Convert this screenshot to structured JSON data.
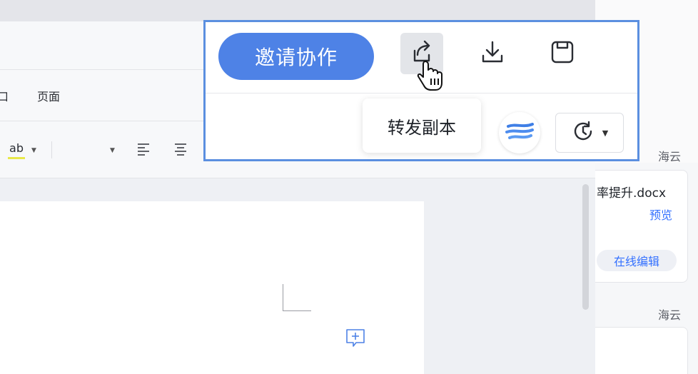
{
  "menu": {
    "partial_item": "口",
    "page_item": "页面"
  },
  "format_bar": {
    "highlight_label": "ab"
  },
  "toolbar": {
    "invite_label": "邀请协作",
    "share_tooltip": "转发副本",
    "share_icon": "share-icon",
    "download_icon": "download-icon",
    "save_icon": "save-icon",
    "history_icon": "history-icon",
    "accent_color": "#4e82e6"
  },
  "side_panel": {
    "items": [
      {
        "sender": "海云",
        "file_name": "率提升.docx",
        "preview_label": "预览",
        "edit_label": "在线编辑"
      },
      {
        "sender": "海云"
      }
    ],
    "link_color": "#3370ff"
  }
}
